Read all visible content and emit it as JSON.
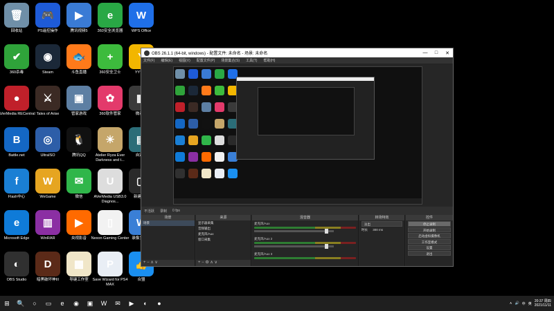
{
  "desktop": {
    "icons": [
      {
        "label": "回收站",
        "glyph": "🗑",
        "color": "#6f8fa8"
      },
      {
        "label": "PS遥控操作",
        "glyph": "🎮",
        "color": "#1e5bd8"
      },
      {
        "label": "腾讯视频5",
        "glyph": "▶",
        "color": "#3a7bd5"
      },
      {
        "label": "360安全浏览器",
        "glyph": "e",
        "color": "#29a845"
      },
      {
        "label": "WPS Office",
        "glyph": "W",
        "color": "#1f6fe8"
      },
      {
        "label": "360杀毒",
        "glyph": "✔",
        "color": "#2fa33a"
      },
      {
        "label": "Steam",
        "glyph": "◉",
        "color": "#1b2838"
      },
      {
        "label": "斗鱼直播",
        "glyph": "🐟",
        "color": "#ff7a1a"
      },
      {
        "label": "360安全卫士",
        "glyph": "+",
        "color": "#3dbb3d"
      },
      {
        "label": "YY语音",
        "glyph": "Y",
        "color": "#f2b600"
      },
      {
        "label": "AVerMedia RECentral",
        "glyph": "●",
        "color": "#c0202a"
      },
      {
        "label": "Tales of Arise",
        "glyph": "⚔",
        "color": "#3b2a24"
      },
      {
        "label": "管家游戏",
        "glyph": "▣",
        "color": "#5d7fa3"
      },
      {
        "label": "360软件管家",
        "glyph": "✿",
        "color": "#e33a6b"
      },
      {
        "label": "微商城",
        "glyph": "▦",
        "color": "#3a3a3a"
      },
      {
        "label": "Battle.net",
        "glyph": "B",
        "color": "#1467c4"
      },
      {
        "label": "UltraISO",
        "glyph": "◎",
        "color": "#2d5ea8"
      },
      {
        "label": "腾讯QQ",
        "glyph": "🐧",
        "color": "#111111"
      },
      {
        "label": "Atelier Ryza Ever Darkness and t...",
        "glyph": "☀",
        "color": "#c5a66a"
      },
      {
        "label": "自定义",
        "glyph": "▤",
        "color": "#2b6d78"
      },
      {
        "label": "Flash中心",
        "glyph": "f",
        "color": "#1a7fd4"
      },
      {
        "label": "WeGame",
        "glyph": "W",
        "color": "#e6a521"
      },
      {
        "label": "微信",
        "glyph": "✉",
        "color": "#30b64a"
      },
      {
        "label": "AVerMedia USB3.0 Diagnos...",
        "glyph": "U",
        "color": "#dddddd"
      },
      {
        "label": "新建文件",
        "glyph": "▢",
        "color": "#2a2a2a"
      },
      {
        "label": "Microsoft Edge",
        "glyph": "e",
        "color": "#0f7bd8"
      },
      {
        "label": "WinRAR",
        "glyph": "▥",
        "color": "#8b2fa3"
      },
      {
        "label": "央视影音",
        "glyph": "▶",
        "color": "#ff6a00"
      },
      {
        "label": "Nexon Gaming Center",
        "glyph": "▯",
        "color": "#f2f2f2"
      },
      {
        "label": "录像文件夹",
        "glyph": "W",
        "color": "#3a7fd6"
      },
      {
        "label": "OBS Studio",
        "glyph": "◐",
        "color": "#303030"
      },
      {
        "label": "暗黑破坏神III",
        "glyph": "D",
        "color": "#5b2a18"
      },
      {
        "label": "导键工作室",
        "glyph": "▦",
        "color": "#f0e6c8"
      },
      {
        "label": "Save Wizard for PS4 MAX",
        "glyph": "P",
        "color": "#e9eef5"
      },
      {
        "label": "合盟",
        "glyph": "👍",
        "color": "#1a8ff0"
      }
    ]
  },
  "obs": {
    "title": "OBS 26.1.1 (64-bit, windows) - 配置文件: 未命名 - 场景: 未命名",
    "window_controls": [
      "—",
      "□",
      "✕"
    ],
    "menu": [
      "文件(F)",
      "编辑(E)",
      "视图(V)",
      "配置文件(P)",
      "场景集合(S)",
      "工具(T)",
      "帮助(H)"
    ],
    "modebar": [
      "不活跃",
      "录制",
      "0 fps"
    ],
    "docks": {
      "scenes": {
        "header": "场景",
        "items": [
          "场景"
        ],
        "footer": "+ −  ∧ ∨"
      },
      "sources": {
        "header": "来源",
        "items": [
          "显示器采集",
          "音频输出",
          "麦克风/Aux",
          "窗口采集"
        ],
        "footer": "+ − ⚙ ∧ ∨"
      },
      "mixer": {
        "header": "混音器",
        "channels": [
          {
            "name": "麦克风/Aux",
            "level": "0.0 dB"
          },
          {
            "name": "麦克风/Aux 2",
            "level": "0.0 dB"
          },
          {
            "name": "麦克风/Aux 3",
            "level": "0.0 dB"
          }
        ]
      },
      "transitions": {
        "header": "转场特效",
        "mode": "淡出",
        "duration_label": "时长",
        "duration": "300 ms"
      },
      "controls": {
        "header": "控件",
        "buttons": [
          "停止录制",
          "开始录制",
          "启动虚拟摄像机",
          "工作室模式",
          "设置",
          "退出"
        ]
      }
    }
  },
  "taskbar": {
    "start": "⊞",
    "items": [
      "🔍",
      "○",
      "▭",
      "e",
      "◉",
      "▣",
      "W",
      "✉",
      "▶",
      "◐",
      "●"
    ],
    "tray": [
      "∧",
      "🔊",
      "中",
      "英"
    ],
    "time": "20:37 周四",
    "date": "2021/11/11"
  }
}
